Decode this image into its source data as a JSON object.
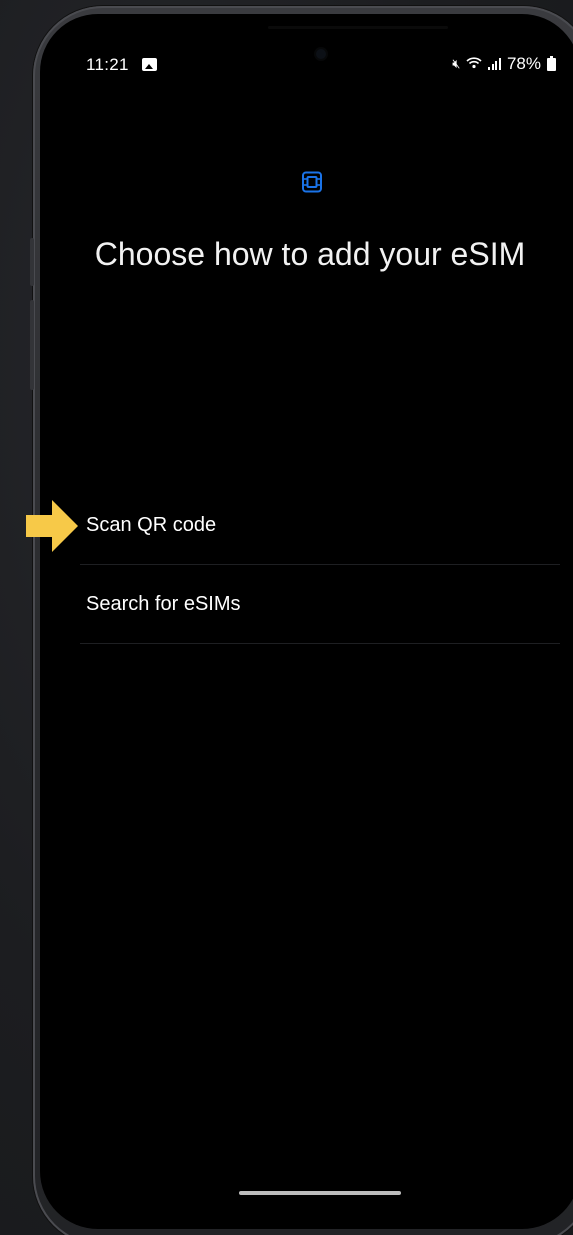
{
  "status_bar": {
    "time": "11:21",
    "battery_percent": "78%",
    "icons": [
      "image-notification-icon",
      "mute-icon",
      "wifi-icon",
      "signal-icon",
      "battery-icon"
    ]
  },
  "header": {
    "icon": "esim-icon",
    "title": "Choose how to add your eSIM"
  },
  "options": [
    {
      "label": "Scan QR code"
    },
    {
      "label": "Search for eSIMs"
    }
  ],
  "highlight": {
    "icon": "pointer-arrow-icon",
    "target": "Scan QR code"
  },
  "colors": {
    "accent": "#1a73e8",
    "arrow": "#f7c948",
    "background": "#000000"
  }
}
